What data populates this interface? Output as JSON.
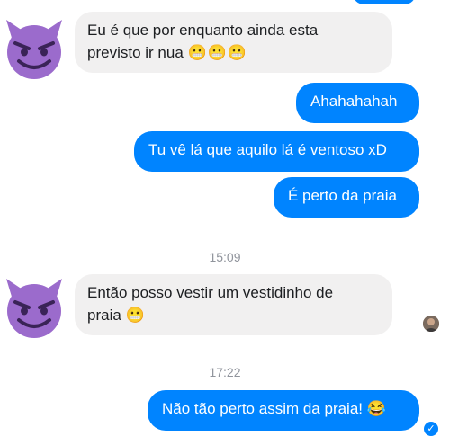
{
  "messages": {
    "m1_line1": "Eu é que por enquanto ainda esta",
    "m1_line2": "previsto ir nua",
    "m1_emoji": "😬😬😬",
    "m2": "Ahahahahah",
    "m3": "Tu vê lá que aquilo lá é ventoso xD",
    "m4": "É perto da praia",
    "m5_line1": "Então posso vestir um vestidinho de",
    "m5_line2": "praia",
    "m5_emoji": "😬",
    "m6": "Não tão perto assim da praia!",
    "m6_emoji": "😂"
  },
  "timestamps": {
    "t1": "15:09",
    "t2": "17:22"
  },
  "icons": {
    "sender_avatar": "smiling-devil-emoji",
    "read_avatar": "seen-profile-picture",
    "delivered": "check-circle-icon"
  },
  "colors": {
    "outgoing": "#0084ff",
    "incoming": "#f1f0f0",
    "avatar": "#9b6bcc"
  }
}
